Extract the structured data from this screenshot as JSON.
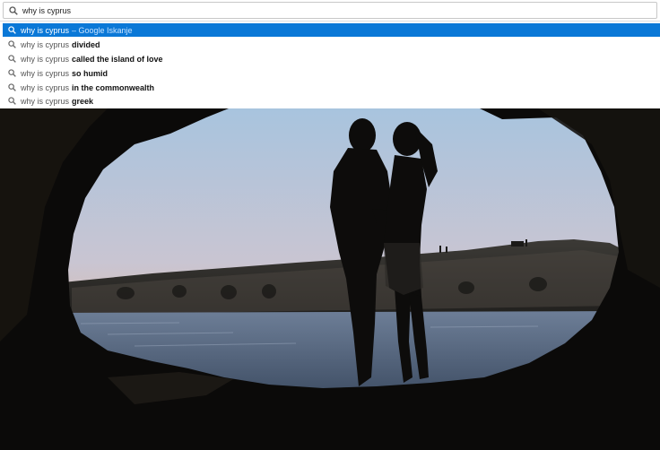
{
  "omnibox": {
    "query": "why is cyprus",
    "icon": "search-icon"
  },
  "suggestions": [
    {
      "query": "why is cyprus",
      "completion": "",
      "hint": "– Google Iskanje",
      "selected": true,
      "icon": "search-icon"
    },
    {
      "query": "why is cyprus",
      "completion": "divided",
      "hint": "",
      "selected": false,
      "icon": "search-icon"
    },
    {
      "query": "why is cyprus",
      "completion": "called the island of love",
      "hint": "",
      "selected": false,
      "icon": "search-icon"
    },
    {
      "query": "why is cyprus",
      "completion": "so humid",
      "hint": "",
      "selected": false,
      "icon": "search-icon"
    },
    {
      "query": "why is cyprus",
      "completion": "in the commonwealth",
      "hint": "",
      "selected": false,
      "icon": "search-icon"
    },
    {
      "query": "why is cyprus",
      "completion": "greek",
      "hint": "",
      "selected": false,
      "icon": "search-icon"
    }
  ],
  "colors": {
    "selected_row": "#0a78d7",
    "sky_top": "#a9c6df",
    "sky_bottom": "#e6b89a"
  },
  "photo": {
    "icon": "couple-silhouette-sea-cave-photo"
  }
}
